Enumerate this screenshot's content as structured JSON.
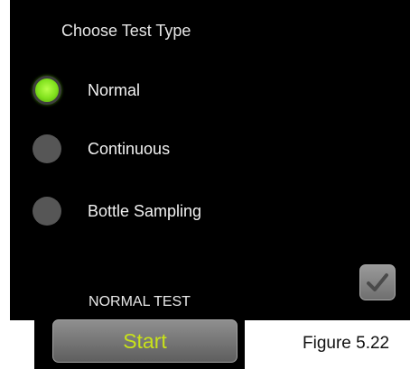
{
  "screen": {
    "title": "Choose Test Type",
    "options": [
      {
        "label": "Normal",
        "selected": true
      },
      {
        "label": "Continuous",
        "selected": false
      },
      {
        "label": "Bottle Sampling",
        "selected": false
      }
    ],
    "confirm_icon": "checkmark-icon"
  },
  "widget": {
    "title": "NORMAL TEST",
    "start_label": "Start"
  },
  "caption": "Figure 5.22",
  "colors": {
    "selected_radio": "#7fe01c",
    "unselected_radio": "#565656",
    "start_text": "#c8e21a",
    "background": "#000000"
  }
}
